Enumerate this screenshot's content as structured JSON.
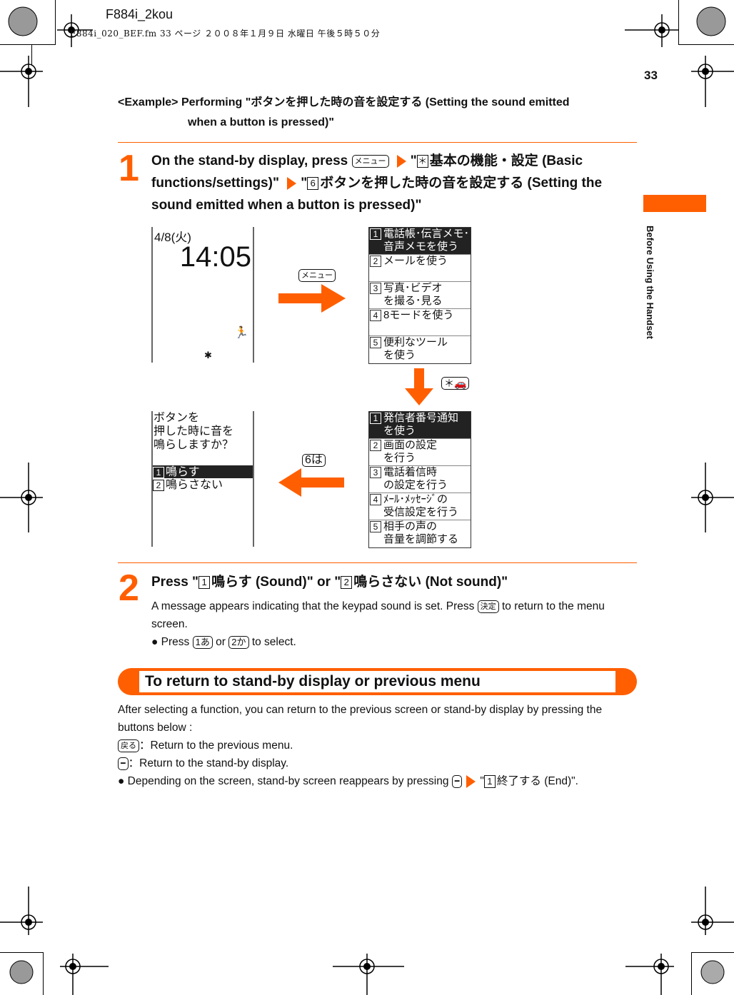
{
  "header": {
    "title": "F884i_2kou",
    "meta": "F884i_020_BEF.fm  33 ページ  ２００８年１月９日  水曜日  午後５時５０分"
  },
  "page_number": "33",
  "side_tab": {
    "label": "Before Using the Handset",
    "color": "#ff5f00"
  },
  "example": {
    "line1": "<Example> Performing \"ボタンを押した時の音を設定する (Setting the sound emitted",
    "line2": "when a button is pressed)\""
  },
  "step1": {
    "number": "1",
    "text_a": "On the stand-by display, press",
    "key_menu": "メニュー",
    "text_b": "\"",
    "key_star": "＊",
    "text_c": "基本の機能・設定 (Basic functions/settings)\"",
    "text_d": "\"",
    "key_six": "6",
    "text_e": "ボタンを押した時の音を設定する (Setting the sound emitted when a button is pressed)\""
  },
  "screens": {
    "standby": {
      "date": "4/8(火)",
      "time": "14:05"
    },
    "menu_key": "メニュー",
    "main_menu": [
      {
        "n": "1",
        "line1": "電話帳･伝言メモ･",
        "line2": "音声メモを使う",
        "selected": true
      },
      {
        "n": "2",
        "line1": "メールを使う",
        "line2": "",
        "selected": false
      },
      {
        "n": "3",
        "line1": "写真･ビデオ",
        "line2": "を撮る･見る",
        "selected": false
      },
      {
        "n": "4",
        "line1": "8モードを使う",
        "line2": "",
        "selected": false
      },
      {
        "n": "5",
        "line1": "便利なツール",
        "line2": "を使う",
        "selected": false
      }
    ],
    "star_key": "＊🚗",
    "settings_menu": [
      {
        "n": "1",
        "line1": "発信者番号通知",
        "line2": "を使う",
        "selected": true
      },
      {
        "n": "2",
        "line1": "画面の設定",
        "line2": "を行う",
        "selected": false
      },
      {
        "n": "3",
        "line1": "電話着信時",
        "line2": "の設定を行う",
        "selected": false
      },
      {
        "n": "4",
        "line1": "ﾒｰﾙ･ﾒｯｾｰｼﾞの",
        "line2": "受信設定を行う",
        "selected": false
      },
      {
        "n": "5",
        "line1": "相手の声の",
        "line2": "音量を調節する",
        "selected": false
      }
    ],
    "six_key": "6は",
    "confirm": {
      "line1": "ボタンを",
      "line2": "押した時に音を",
      "line3": "鳴らしますか？",
      "options": [
        {
          "n": "1",
          "label": "鳴らす",
          "selected": true
        },
        {
          "n": "2",
          "label": "鳴らさない",
          "selected": false
        }
      ]
    }
  },
  "step2": {
    "number": "2",
    "title_a": "Press \"",
    "k1": "1",
    "title_b": "鳴らす (Sound)\" or \"",
    "k2": "2",
    "title_c": "鳴らさない (Not sound)\"",
    "desc_a": "A message appears indicating that the keypad sound is set. Press",
    "key_ok": "決定",
    "desc_b": "to return to the menu screen.",
    "bullet_a": "● Press",
    "key_1": "1あ",
    "bullet_or": "or",
    "key_2": "2か",
    "bullet_b": "to select."
  },
  "section": {
    "title": "To return to stand-by display or previous menu",
    "intro": "After selecting a function, you can return to the previous screen or stand-by display by pressing the buttons below :",
    "key_back": "戻る",
    "back_text": "：Return to the previous menu.",
    "key_end": "━",
    "end_text": "：Return to the stand-by display.",
    "bullet_a": "● Depending on the screen, stand-by screen reappears by pressing",
    "bullet_key": "━",
    "bullet_b": "\"",
    "bullet_num": "1",
    "bullet_c": "終了する (End)\"."
  }
}
